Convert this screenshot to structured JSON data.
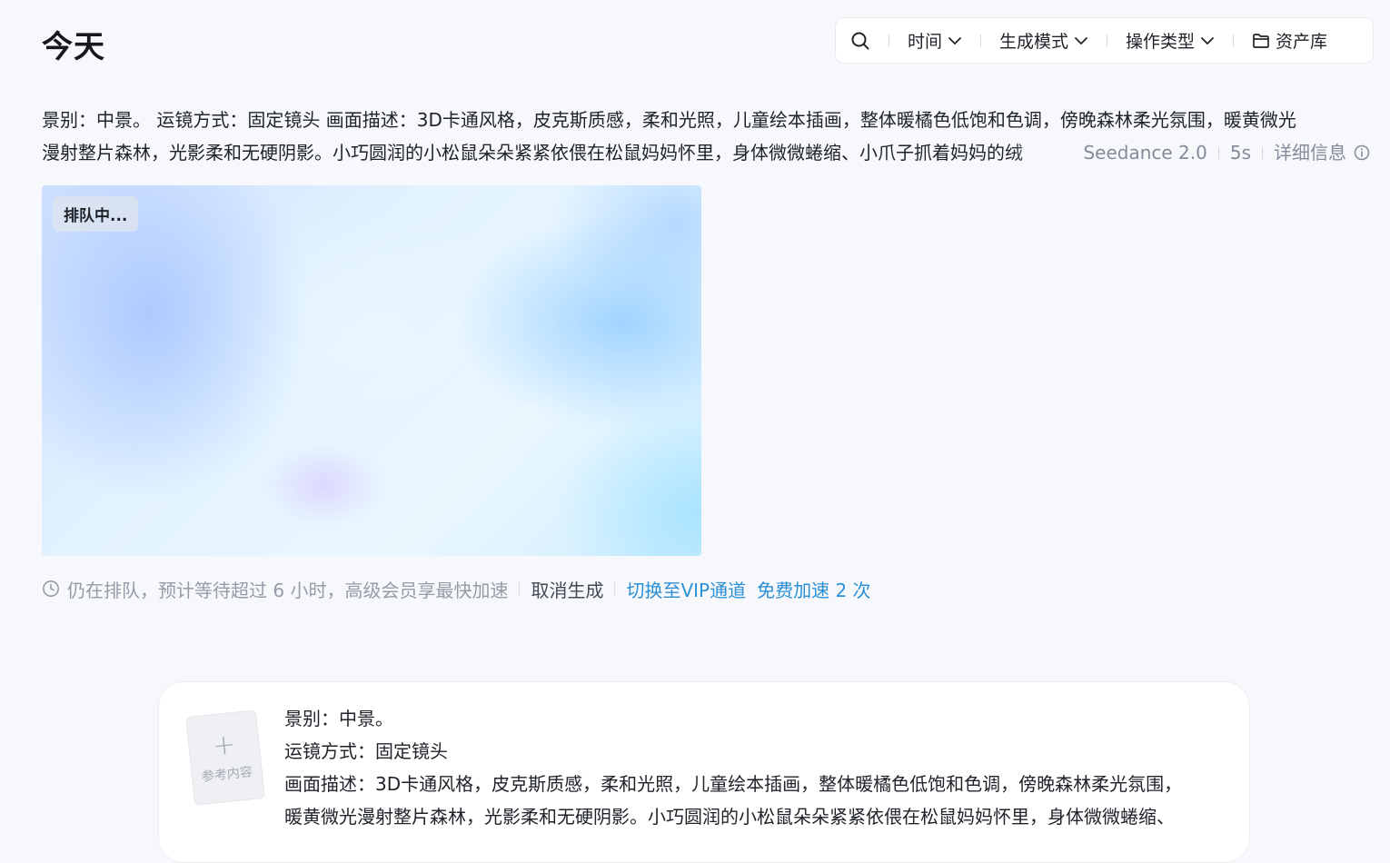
{
  "header": {
    "title": "今天"
  },
  "toolbar": {
    "search_icon": "search-icon",
    "filters": [
      {
        "label": "时间"
      },
      {
        "label": "生成模式"
      },
      {
        "label": "操作类型"
      }
    ],
    "asset_library_label": "资产库"
  },
  "task": {
    "prompt_line1": "景别：中景。 运镜方式：固定镜头 画面描述：3D卡通风格，皮克斯质感，柔和光照，儿童绘本插画，整体暖橘色低饱和色调，傍晚森林柔光氛围，暖黄微光",
    "prompt_line2": "漫射整片森林，光影柔和无硬阴影。小巧圆润的小松鼠朵朵紧紧依偎在松鼠妈妈怀里，身体微微蜷缩、小爪子抓着妈妈的绒",
    "model": "Seedance 2.0",
    "duration": "5s",
    "details_label": "详细信息",
    "status_badge": "排队中...",
    "wait_text": "仍在排队，预计等待超过 6 小时，高级会员享最快加速",
    "cancel_label": "取消生成",
    "vip_label": "切换至VIP通道",
    "free_speed_label": "免费加速 2 次"
  },
  "composer": {
    "reference_label": "参考内容",
    "lines": [
      "景别：中景。",
      "运镜方式：固定镜头",
      "画面描述：3D卡通风格，皮克斯质感，柔和光照，儿童绘本插画，整体暖橘色低饱和色调，傍晚森林柔光氛围，",
      "暖黄微光漫射整片森林，光影柔和无硬阴影。小巧圆润的小松鼠朵朵紧紧依偎在松鼠妈妈怀里，身体微微蜷缩、"
    ]
  },
  "colors": {
    "accent": "#2b8fd6",
    "muted": "#959ba7",
    "background": "#f7f8fb"
  }
}
